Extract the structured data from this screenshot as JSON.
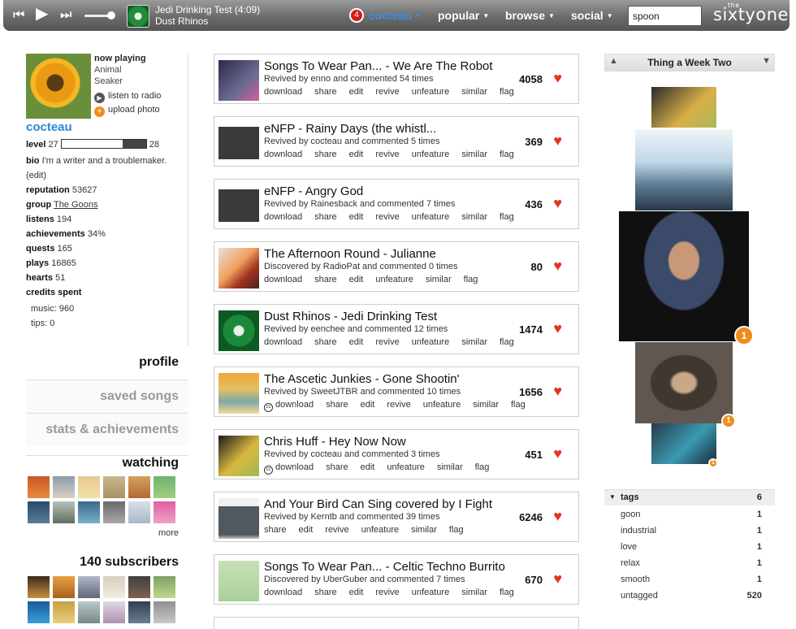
{
  "player": {
    "now_title": "Jedi Drinking Test (4:09)",
    "now_artist": "Dust Rhinos"
  },
  "nav": {
    "notification_count": "4",
    "user": "cocteau",
    "items": [
      "popular",
      "browse",
      "social"
    ],
    "search_value": "spoon",
    "logo_the": "the",
    "logo": "sixtyone"
  },
  "profile": {
    "now_playing_label": "now playing",
    "song": "Animal",
    "artist": "Seaker",
    "listen_label": "listen to radio",
    "upload_label": "upload photo",
    "username": "cocteau",
    "level_label": "level",
    "level_current": "27",
    "level_next": "28",
    "level_progress": 0.72,
    "bio_label": "bio",
    "bio": "I'm a writer and a troublemaker.",
    "edit": "(edit)",
    "reputation_label": "reputation",
    "reputation": "53627",
    "group_label": "group",
    "group": "The Goons",
    "listens_label": "listens",
    "listens": "194",
    "achievements_label": "achievements",
    "achievements": "34%",
    "quests_label": "quests",
    "quests": "165",
    "plays_label": "plays",
    "plays": "16865",
    "hearts_label": "hearts",
    "hearts": "51",
    "credits_label": "credits spent",
    "music_label": "music:",
    "music": "960",
    "tips_label": "tips:",
    "tips": "0"
  },
  "tabs": [
    "profile",
    "saved songs",
    "stats & achievements"
  ],
  "watching": {
    "title": "watching",
    "more": "more"
  },
  "subscribers": {
    "title": "140 subscribers"
  },
  "feed": [
    {
      "title": "Songs To Wear Pan... - We Are The Robot",
      "meta": "Revived by enno and commented 54 times",
      "actions": [
        "download",
        "share",
        "edit",
        "revive",
        "unfeature",
        "similar",
        "flag"
      ],
      "count": "4058",
      "cc": false
    },
    {
      "title": "eNFP - Rainy Days (the whistl...",
      "meta": "Revived by cocteau and commented 5 times",
      "actions": [
        "download",
        "share",
        "edit",
        "revive",
        "unfeature",
        "similar",
        "flag"
      ],
      "count": "369",
      "cc": false
    },
    {
      "title": "eNFP - Angry God",
      "meta": "Revived by Rainesback and commented 7 times",
      "actions": [
        "download",
        "share",
        "edit",
        "revive",
        "unfeature",
        "similar",
        "flag"
      ],
      "count": "436",
      "cc": false
    },
    {
      "title": "The Afternoon Round - Julianne",
      "meta": "Discovered by RadioPat and commented 0 times",
      "actions": [
        "download",
        "share",
        "edit",
        "unfeature",
        "similar",
        "flag"
      ],
      "count": "80",
      "cc": false
    },
    {
      "title": "Dust Rhinos - Jedi Drinking Test",
      "meta": "Revived by eenchee and commented 12 times",
      "actions": [
        "download",
        "share",
        "edit",
        "revive",
        "unfeature",
        "similar",
        "flag"
      ],
      "count": "1474",
      "cc": false
    },
    {
      "title": "The Ascetic Junkies - Gone Shootin'",
      "meta": "Revived by SweetJTBR and commented 10 times",
      "actions": [
        "download",
        "share",
        "edit",
        "revive",
        "unfeature",
        "similar",
        "flag"
      ],
      "count": "1656",
      "cc": true
    },
    {
      "title": "Chris Huff - Hey Now Now",
      "meta": "Revived by cocteau and commented 3 times",
      "actions": [
        "download",
        "share",
        "edit",
        "unfeature",
        "similar",
        "flag"
      ],
      "count": "451",
      "cc": true
    },
    {
      "title": "And Your Bird Can Sing covered by I Fight",
      "meta": "Revived by Kerntb and commented 39 times",
      "actions": [
        "share",
        "edit",
        "revive",
        "unfeature",
        "similar",
        "flag"
      ],
      "count": "6246",
      "cc": false
    },
    {
      "title": "Songs To Wear Pan... - Celtic Techno Burrito",
      "meta": "Discovered by UberGuber and commented 7 times",
      "actions": [
        "download",
        "share",
        "edit",
        "revive",
        "unfeature",
        "similar",
        "flag"
      ],
      "count": "670",
      "cc": false
    }
  ],
  "playlist": {
    "title": "Thing a Week Two",
    "badges": [
      "1",
      "1",
      "1"
    ]
  },
  "tags": {
    "title": "tags",
    "count": "6",
    "rows": [
      {
        "name": "goon",
        "n": "1"
      },
      {
        "name": "industrial",
        "n": "1"
      },
      {
        "name": "love",
        "n": "1"
      },
      {
        "name": "relax",
        "n": "1"
      },
      {
        "name": "smooth",
        "n": "1"
      },
      {
        "name": "untagged",
        "n": "520"
      }
    ]
  },
  "colors": {
    "accent": "#2b87d8",
    "heart": "#e0361a",
    "badge": "#f08c1a"
  }
}
